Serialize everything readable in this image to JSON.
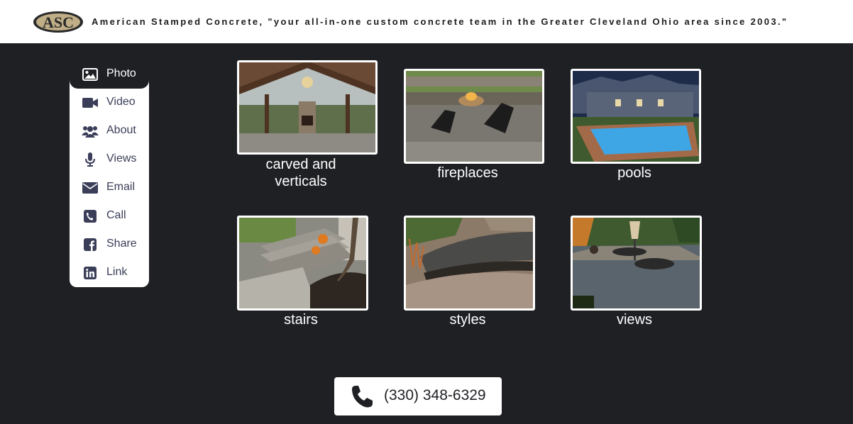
{
  "header": {
    "logo_text": "ASC",
    "tagline": "American Stamped Concrete, \"your all-in-one custom concrete team in the Greater Cleveland Ohio area since 2003.\""
  },
  "sidebar": {
    "items": [
      {
        "label": "Photo",
        "icon": "image-icon",
        "active": true
      },
      {
        "label": "Video",
        "icon": "video-camera-icon",
        "active": false
      },
      {
        "label": "About",
        "icon": "users-icon",
        "active": false
      },
      {
        "label": "Views",
        "icon": "microphone-icon",
        "active": false
      },
      {
        "label": "Email",
        "icon": "envelope-icon",
        "active": false
      },
      {
        "label": "Call",
        "icon": "phone-square-icon",
        "active": false
      },
      {
        "label": "Share",
        "icon": "facebook-icon",
        "active": false
      },
      {
        "label": "Link",
        "icon": "linkedin-icon",
        "active": false
      }
    ]
  },
  "gallery": {
    "tiles": [
      {
        "caption_line1": "carved and",
        "caption_line2": "verticals"
      },
      {
        "caption_line1": "fireplaces"
      },
      {
        "caption_line1": "pools"
      },
      {
        "caption_line1": "stairs"
      },
      {
        "caption_line1": "styles"
      },
      {
        "caption_line1": "views"
      }
    ]
  },
  "call_button": {
    "phone": "(330) 348-6329",
    "icon": "phone-icon"
  },
  "colors": {
    "background": "#1f2024",
    "sidebar_text": "#3a3e58",
    "white": "#ffffff"
  }
}
